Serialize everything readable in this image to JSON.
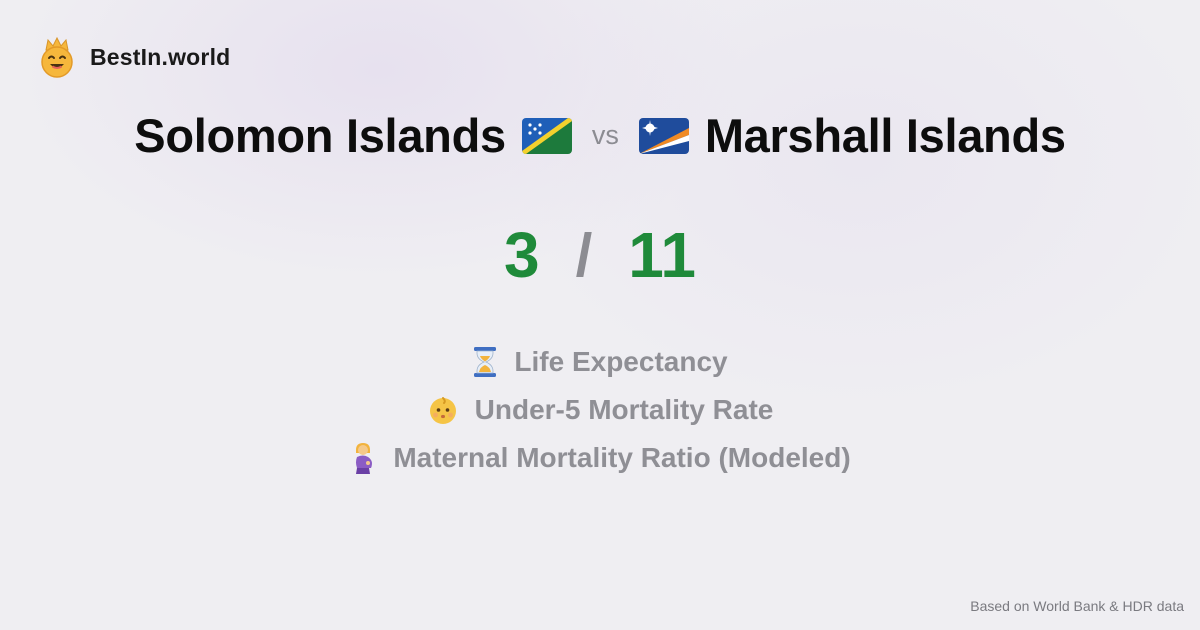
{
  "brand": {
    "name": "BestIn.world",
    "icon": "crowned-smiley-icon"
  },
  "comparison": {
    "country_a": "Solomon Islands",
    "country_a_flag": "solomon-islands-flag-icon",
    "vs_label": "vs",
    "country_b": "Marshall Islands",
    "country_b_flag": "marshall-islands-flag-icon"
  },
  "score": {
    "a": "3",
    "separator": "/",
    "b": "11",
    "color": "#1f8a3a"
  },
  "metrics": [
    {
      "icon": "hourglass-icon",
      "label": "Life Expectancy"
    },
    {
      "icon": "baby-face-icon",
      "label": "Under-5 Mortality Rate"
    },
    {
      "icon": "pregnant-woman-icon",
      "label": "Maternal Mortality Ratio (Modeled)"
    }
  ],
  "footer": {
    "source": "Based on World Bank & HDR data"
  }
}
